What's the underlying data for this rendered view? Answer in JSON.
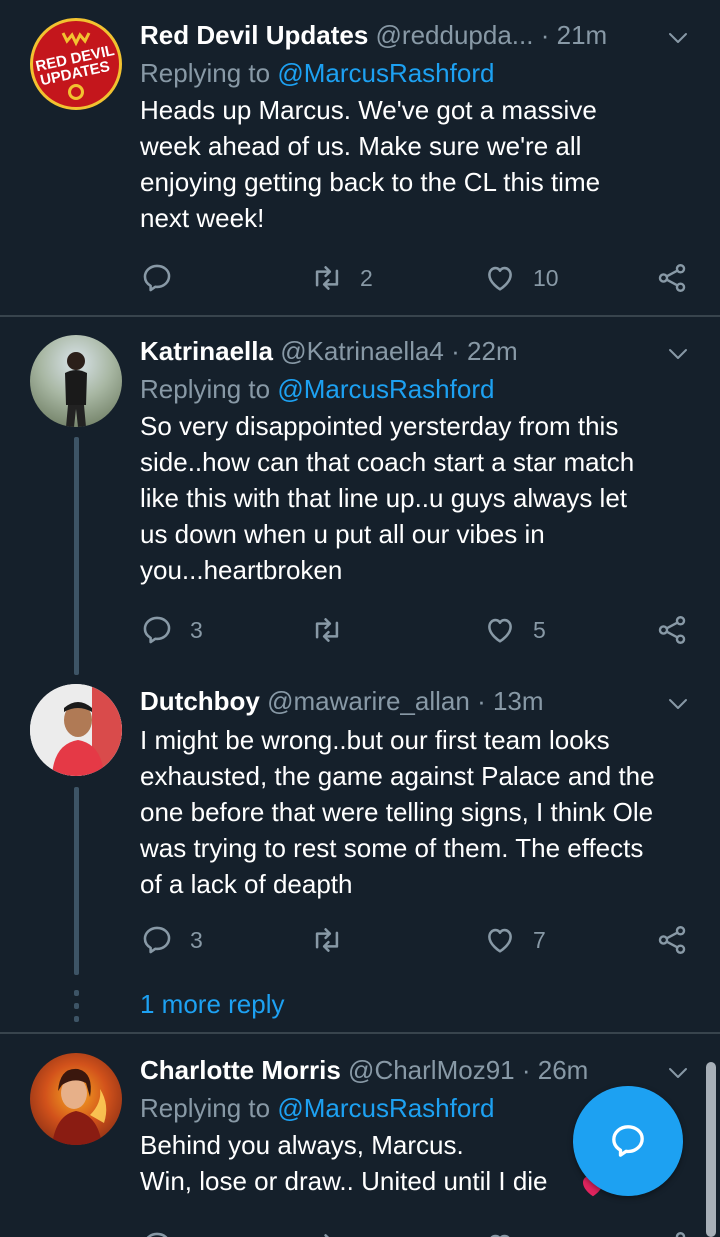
{
  "colors": {
    "background": "#15202b",
    "secondary_text": "#8899a6",
    "accent": "#1da1f2",
    "divider": "#38444d"
  },
  "tweets": [
    {
      "name": "Red Devil Updates",
      "handle": "@reddupda...",
      "sep": "·",
      "time": "21m",
      "replying_prefix": "Replying to ",
      "replying_to": "@MarcusRashford",
      "text": "Heads up Marcus. We've got a massive\nweek ahead of us. Make sure we're all\nenjoying getting back to the CL this time\nnext week!",
      "replies": "",
      "retweets": "2",
      "likes": "10",
      "avatar_text_1": "RED DEVIL",
      "avatar_text_2": "UPDATES",
      "avatar_icon": "red-devil-logo"
    },
    {
      "name": "Katrinaella",
      "handle": "@Katrinaella4",
      "sep": "·",
      "time": "22m",
      "replying_prefix": "Replying to ",
      "replying_to": "@MarcusRashford",
      "text": "So very disappointed yersterday from this\nside..how can that coach start a star match\nlike this with that line up..u guys always let\nus down when u put all our vibes in\nyou...heartbroken",
      "replies": "3",
      "retweets": "",
      "likes": "5"
    },
    {
      "name": "Dutchboy",
      "handle": "@mawarire_allan",
      "sep": "·",
      "time": "13m",
      "text": "I might be wrong..but our first team looks\nexhausted, the game against Palace and the\none before that were telling signs, I think Ole\nwas trying to rest some of them. The effects\nof a lack of deapth",
      "replies": "3",
      "retweets": "",
      "likes": "7"
    },
    {
      "name": "Charlotte Morris",
      "handle": "@CharlMoz91",
      "sep": "·",
      "time": "26m",
      "replying_prefix": "Replying to ",
      "replying_to": "@MarcusRashford",
      "text": "Behind you always, Marcus.\nWin, lose or draw.. United until I die"
    }
  ],
  "more_reply": "1 more reply",
  "icons": [
    "reply-icon",
    "retweet-icon",
    "like-icon",
    "share-icon",
    "chevron-down-icon",
    "compose-reply-icon"
  ]
}
